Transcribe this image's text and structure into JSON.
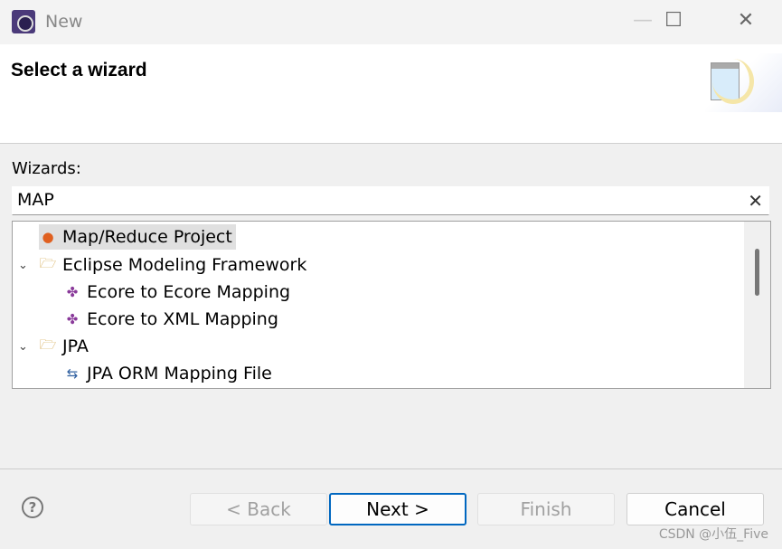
{
  "window": {
    "title": "New"
  },
  "header": {
    "title": "Select a wizard"
  },
  "wizards": {
    "label": "Wizards:",
    "filter_value": "MAP"
  },
  "tree": [
    {
      "label": "Map/Reduce Project",
      "icon": "mapreduce-icon",
      "level": 0,
      "selected": true
    },
    {
      "label": "Eclipse Modeling Framework",
      "icon": "folder-open-icon",
      "level": 0,
      "expanded": true
    },
    {
      "label": "Ecore to Ecore Mapping",
      "icon": "ecore-mapping-icon",
      "level": 1
    },
    {
      "label": "Ecore to XML Mapping",
      "icon": "ecore-xml-icon",
      "level": 1
    },
    {
      "label": "JPA",
      "icon": "folder-open-icon",
      "level": 0,
      "expanded": true
    },
    {
      "label": "JPA ORM Mapping File",
      "icon": "jpa-orm-icon",
      "level": 1
    }
  ],
  "buttons": {
    "back": "< Back",
    "next": "Next >",
    "finish": "Finish",
    "cancel": "Cancel",
    "help": "?"
  },
  "watermark": "CSDN @小伍_Five",
  "colors": {
    "accent": "#0067c0"
  }
}
